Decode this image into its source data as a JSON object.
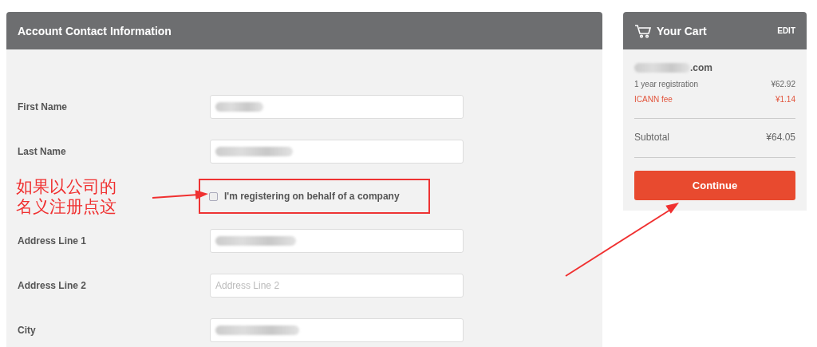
{
  "form": {
    "title": "Account Contact Information",
    "rows": [
      {
        "kind": "field",
        "label": "First Name",
        "value_blurred": true
      },
      {
        "kind": "field",
        "label": "Last Name",
        "value_blurred": true
      },
      {
        "kind": "checkbox",
        "label": "I'm registering on behalf of a company",
        "checked": false,
        "note_lines": [
          "如果以公司的",
          "名义注册点这"
        ]
      },
      {
        "kind": "field",
        "label": "Address Line 1",
        "value_blurred": true
      },
      {
        "kind": "field",
        "label": "Address Line 2",
        "placeholder": "Address Line 2",
        "value_blurred": false
      },
      {
        "kind": "field",
        "label": "City",
        "value_blurred": true
      }
    ]
  },
  "cart": {
    "title": "Your Cart",
    "edit": "EDIT",
    "domain": ".com",
    "lines": [
      {
        "kind": "base",
        "label": "1 year registration",
        "price": "¥62.92"
      },
      {
        "kind": "fee",
        "label": "ICANN fee",
        "price": "¥1.14"
      }
    ],
    "subtotal_label": "Subtotal",
    "subtotal": "¥64.05",
    "button": "Continue"
  }
}
